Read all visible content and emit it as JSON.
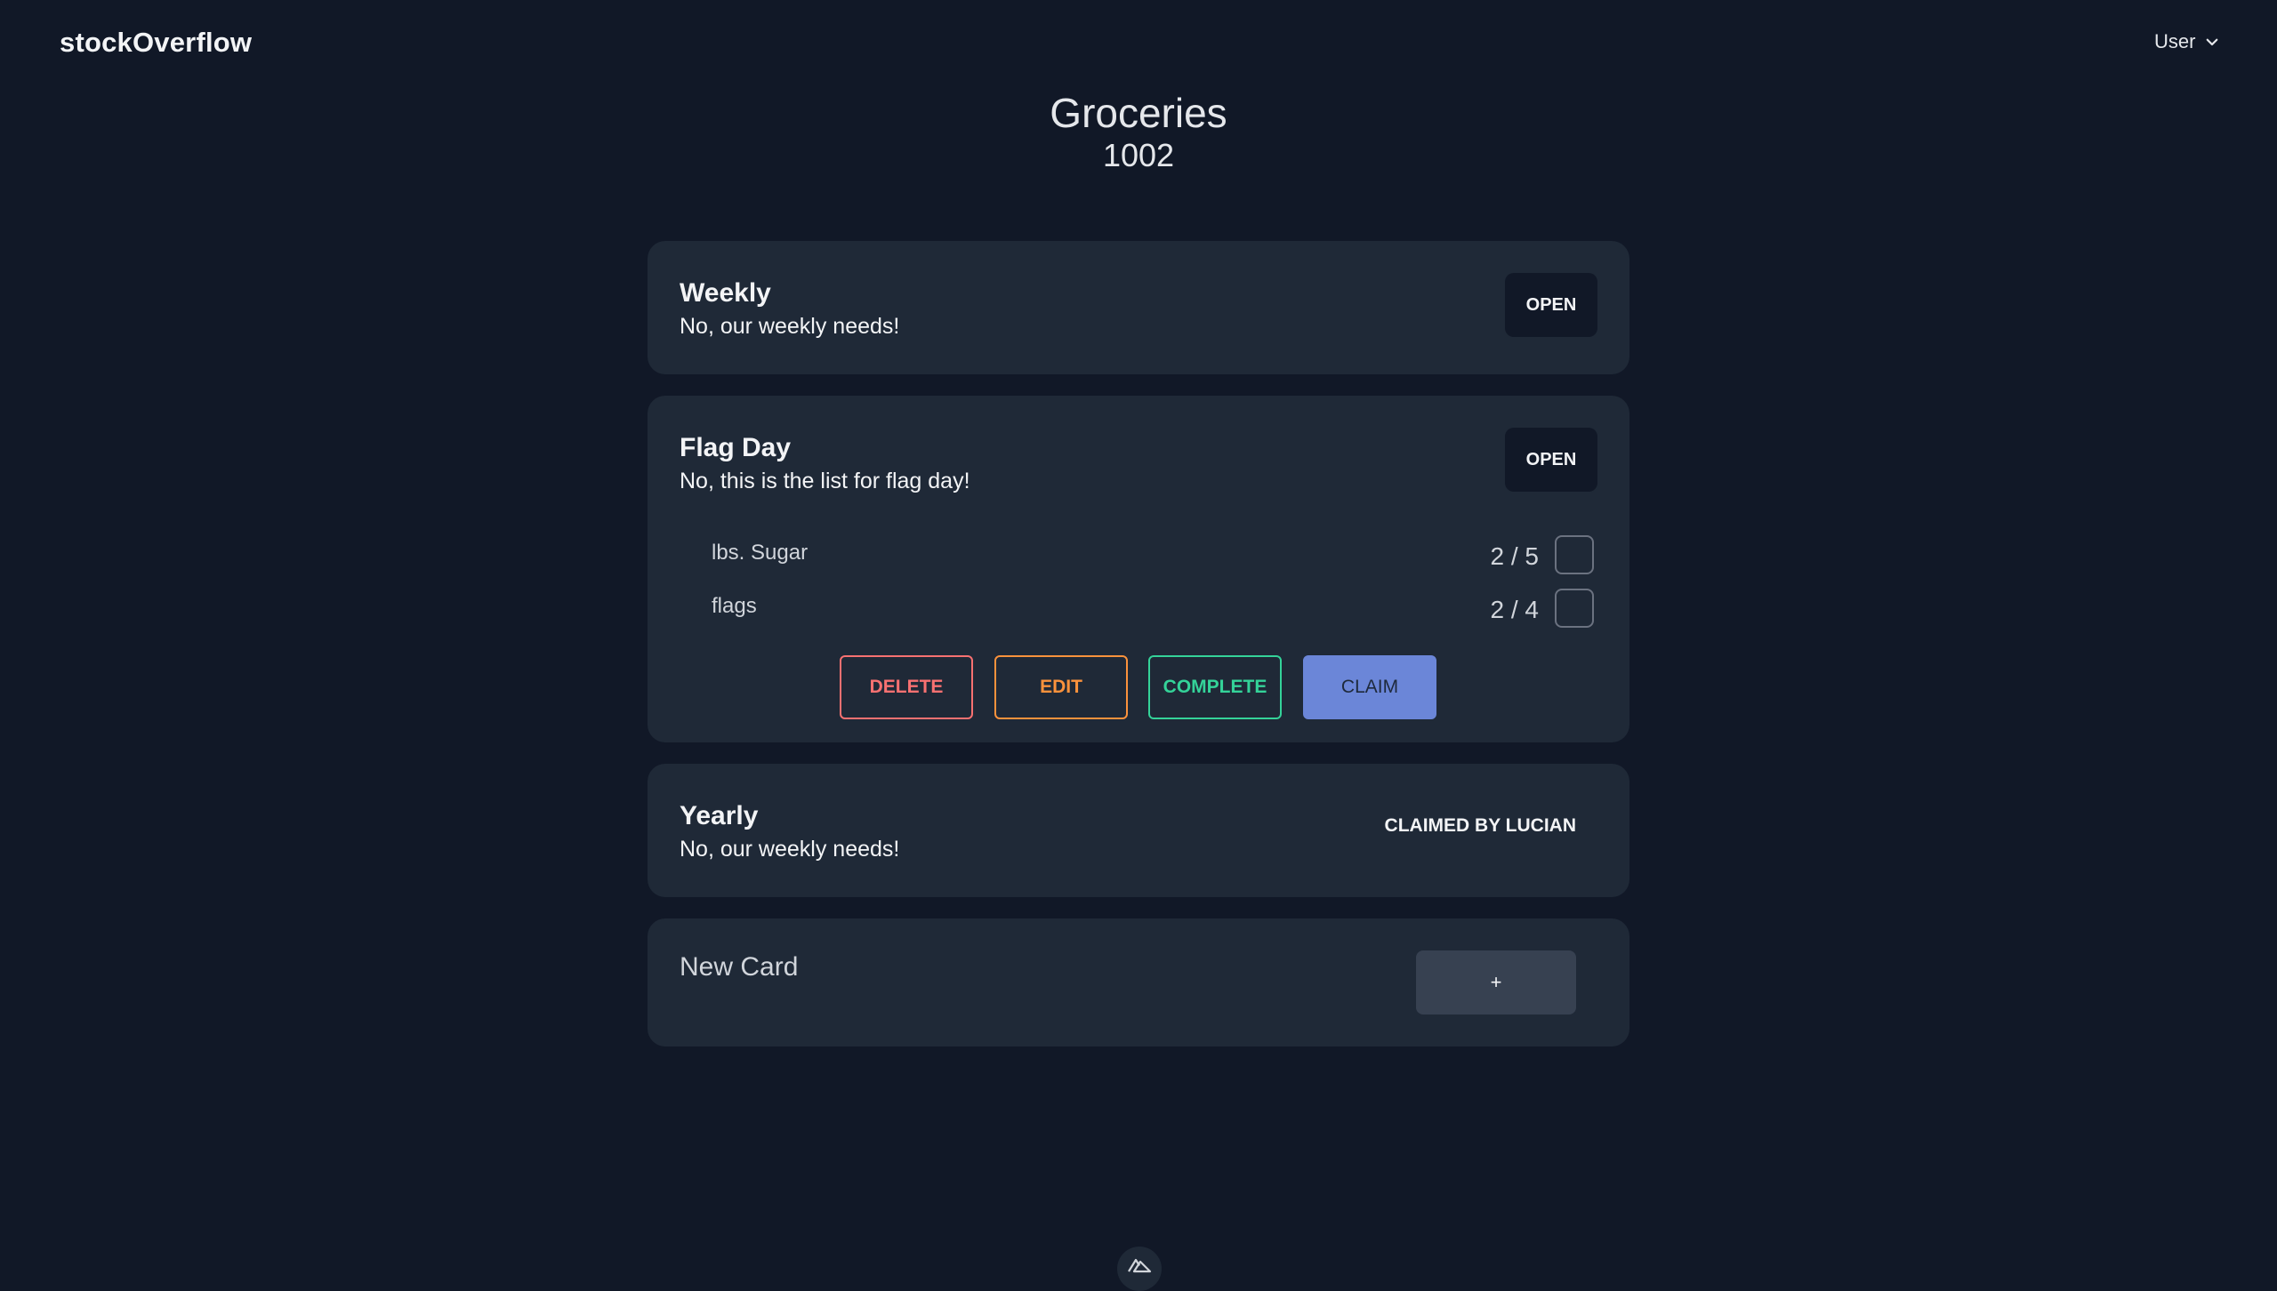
{
  "header": {
    "brand": "stockOverflow",
    "user_label": "User"
  },
  "page": {
    "title": "Groceries",
    "subtitle": "1002"
  },
  "cards": [
    {
      "title": "Weekly",
      "description": "No, our weekly needs!",
      "status": "OPEN"
    },
    {
      "title": "Flag Day",
      "description": "No, this is the list for flag day!",
      "status": "OPEN",
      "items": [
        {
          "name": "lbs. Sugar",
          "count": "2 / 5"
        },
        {
          "name": "flags",
          "count": "2 / 4"
        }
      ],
      "actions": {
        "delete": "DELETE",
        "edit": "EDIT",
        "complete": "COMPLETE",
        "claim": "CLAIM"
      }
    },
    {
      "title": "Yearly",
      "description": "No, our weekly needs!",
      "status": "CLAIMED BY LUCIAN"
    }
  ],
  "new_card": {
    "label": "New Card",
    "add_label": "+"
  },
  "colors": {
    "background": "#111827",
    "card": "#1f2937",
    "delete": "#f87171",
    "edit": "#fb923c",
    "complete": "#34d399",
    "claim": "#6b86d8"
  },
  "icons": {
    "user_menu": "chevron-down-icon",
    "footer": "nuxt-logo-icon"
  }
}
